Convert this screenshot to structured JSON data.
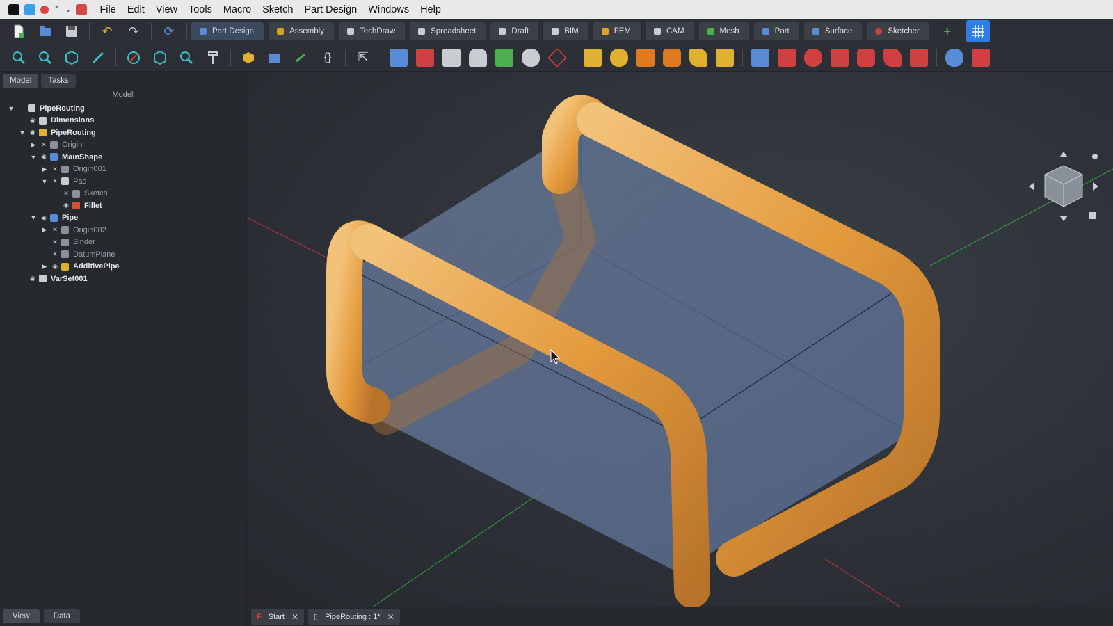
{
  "menubar": {
    "items": [
      "File",
      "Edit",
      "View",
      "Tools",
      "Macro",
      "Sketch",
      "Part Design",
      "Windows",
      "Help"
    ]
  },
  "workbenches": [
    {
      "label": "Part Design",
      "color": "#5a8bd6"
    },
    {
      "label": "Assembly",
      "color": "#d0a030"
    },
    {
      "label": "TechDraw",
      "color": "#c9ccd1"
    },
    {
      "label": "Spreadsheet",
      "color": "#c9ccd1"
    },
    {
      "label": "Draft",
      "color": "#c9ccd1"
    },
    {
      "label": "BIM",
      "color": "#c9ccd1"
    },
    {
      "label": "FEM",
      "color": "#e0a030"
    },
    {
      "label": "CAM",
      "color": "#c9ccd1"
    },
    {
      "label": "Mesh",
      "color": "#4caf50"
    },
    {
      "label": "Part",
      "color": "#5a8bd6"
    },
    {
      "label": "Surface",
      "color": "#5a8bd6"
    },
    {
      "label": "Sketcher",
      "color": "#d04040"
    }
  ],
  "panel": {
    "tabs": [
      "Model",
      "Tasks"
    ],
    "title": "Model",
    "bottom_tabs": [
      "View",
      "Data"
    ]
  },
  "tree": [
    {
      "label": "PipeRouting",
      "arrow": "▼",
      "eye": "",
      "icon": "#c9ccd1",
      "dim": false
    },
    {
      "label": "Dimensions",
      "arrow": "",
      "eye": "◉",
      "icon": "#c9ccd1",
      "dim": false
    },
    {
      "label": "PipeRouting",
      "arrow": "▼",
      "eye": "◉",
      "icon": "#e0b030",
      "dim": false
    },
    {
      "label": "Origin",
      "arrow": "▶",
      "eye": "✕",
      "icon": "#8a9099",
      "dim": true
    },
    {
      "label": "MainShape",
      "arrow": "▼",
      "eye": "◉",
      "icon": "#5a8bd6",
      "dim": false
    },
    {
      "label": "Origin001",
      "arrow": "▶",
      "eye": "✕",
      "icon": "#8a9099",
      "dim": true
    },
    {
      "label": "Pad",
      "arrow": "▼",
      "eye": "✕",
      "icon": "#c9ccd1",
      "dim": true
    },
    {
      "label": "Sketch",
      "arrow": "",
      "eye": "✕",
      "icon": "#8a9099",
      "dim": true
    },
    {
      "label": "Fillet",
      "arrow": "",
      "eye": "◉",
      "icon": "#d05030",
      "dim": false
    },
    {
      "label": "Pipe",
      "arrow": "▼",
      "eye": "◉",
      "icon": "#5a8bd6",
      "dim": false
    },
    {
      "label": "Origin002",
      "arrow": "▶",
      "eye": "✕",
      "icon": "#8a9099",
      "dim": true
    },
    {
      "label": "Binder",
      "arrow": "",
      "eye": "✕",
      "icon": "#8a9099",
      "dim": true
    },
    {
      "label": "DatumPlane",
      "arrow": "",
      "eye": "✕",
      "icon": "#8a9099",
      "dim": true
    },
    {
      "label": "AdditivePipe",
      "arrow": "▶",
      "eye": "◉",
      "icon": "#e0b030",
      "dim": false
    },
    {
      "label": "VarSet001",
      "arrow": "",
      "eye": "◉",
      "icon": "#c9ccd1",
      "dim": false
    }
  ],
  "document_tabs": [
    {
      "label": "Start"
    },
    {
      "label": "PipeRouting : 1*"
    }
  ],
  "colors": {
    "accent": "#2f7ee6",
    "pipe": "#e8a84a",
    "box": "#6f84a8"
  }
}
